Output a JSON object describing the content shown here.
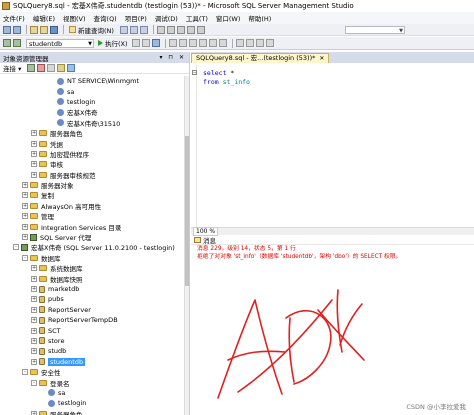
{
  "window": {
    "title": "SQLQuery8.sql - 宏基X伟奇.studentdb (testlogin (53))* - Microsoft SQL Server Management Studio"
  },
  "menu": [
    "文件(F)",
    "编辑(E)",
    "视图(V)",
    "查询(Q)",
    "项目(P)",
    "调试(D)",
    "工具(T)",
    "窗口(W)",
    "帮助(H)"
  ],
  "toolbar": {
    "new_query": "新建查询(N)",
    "database": "studentdb",
    "execute": "执行(X)"
  },
  "object_explorer": {
    "title": "对象资源管理器",
    "header_controls": "▾ ⊓ ✕",
    "connect_label": "连接 ▾",
    "tree": [
      {
        "label": "NT SERVICE\\Winmgmt",
        "icon": "user-icon",
        "level": 5,
        "expander": ""
      },
      {
        "label": "sa",
        "icon": "user-icon",
        "level": 5,
        "expander": ""
      },
      {
        "label": "testlogin",
        "icon": "user-icon",
        "level": 5,
        "expander": ""
      },
      {
        "label": "宏基X伟奇",
        "icon": "user-icon",
        "level": 5,
        "expander": ""
      },
      {
        "label": "宏基X伟奇\\31510",
        "icon": "user-icon",
        "level": 5,
        "expander": ""
      },
      {
        "label": "服务器角色",
        "icon": "folder-icon",
        "level": 3,
        "expander": "+"
      },
      {
        "label": "凭据",
        "icon": "folder-icon",
        "level": 3,
        "expander": "+"
      },
      {
        "label": "加密提供程序",
        "icon": "folder-icon",
        "level": 3,
        "expander": "+"
      },
      {
        "label": "审核",
        "icon": "folder-icon",
        "level": 3,
        "expander": "+"
      },
      {
        "label": "服务器审核规范",
        "icon": "folder-icon",
        "level": 3,
        "expander": "+"
      },
      {
        "label": "服务器对象",
        "icon": "folder-icon",
        "level": 2,
        "expander": "+"
      },
      {
        "label": "复制",
        "icon": "folder-icon",
        "level": 2,
        "expander": "+"
      },
      {
        "label": "AlwaysOn 高可用性",
        "icon": "folder-icon",
        "level": 2,
        "expander": "+"
      },
      {
        "label": "管理",
        "icon": "folder-icon",
        "level": 2,
        "expander": "+"
      },
      {
        "label": "Integration Services 目录",
        "icon": "folder-icon",
        "level": 2,
        "expander": "+"
      },
      {
        "label": "SQL Server 代理",
        "icon": "server-icon",
        "level": 2,
        "expander": "+"
      },
      {
        "label": "宏基X伟奇 (SQL Server 11.0.2100 - testlogin)",
        "icon": "server-icon",
        "level": 1,
        "expander": "-"
      },
      {
        "label": "数据库",
        "icon": "folder-icon",
        "level": 2,
        "expander": "-"
      },
      {
        "label": "系统数据库",
        "icon": "folder-icon",
        "level": 3,
        "expander": "+"
      },
      {
        "label": "数据库快照",
        "icon": "folder-icon",
        "level": 3,
        "expander": "+"
      },
      {
        "label": "marketdb",
        "icon": "db-icon",
        "level": 3,
        "expander": "+"
      },
      {
        "label": "pubs",
        "icon": "db-icon",
        "level": 3,
        "expander": "+"
      },
      {
        "label": "ReportServer",
        "icon": "db-icon",
        "level": 3,
        "expander": "+"
      },
      {
        "label": "ReportServerTempDB",
        "icon": "db-icon",
        "level": 3,
        "expander": "+"
      },
      {
        "label": "SCT",
        "icon": "db-icon",
        "level": 3,
        "expander": "+"
      },
      {
        "label": "store",
        "icon": "db-icon",
        "level": 3,
        "expander": "+"
      },
      {
        "label": "studb",
        "icon": "db-icon",
        "level": 3,
        "expander": "+"
      },
      {
        "label": "studentdb",
        "icon": "db-icon",
        "level": 3,
        "expander": "+",
        "selected": true
      },
      {
        "label": "安全性",
        "icon": "folder-icon",
        "level": 2,
        "expander": "-"
      },
      {
        "label": "登录名",
        "icon": "folder-icon",
        "level": 3,
        "expander": "-"
      },
      {
        "label": "sa",
        "icon": "user-icon",
        "level": 4,
        "expander": ""
      },
      {
        "label": "testlogin",
        "icon": "user-icon",
        "level": 4,
        "expander": ""
      },
      {
        "label": "服务器角色",
        "icon": "folder-icon",
        "level": 3,
        "expander": "+"
      }
    ]
  },
  "editor": {
    "tab_label": "SQLQuery8.sql - 宏...(testlogin (53))*",
    "tab_close": "✕",
    "line1_kw": "select",
    "line1_rest": " *",
    "line2_kw": "from",
    "line2_table": "st_info"
  },
  "zoom": {
    "level": "100 %"
  },
  "messages": {
    "tab_label": "消息",
    "line1": "消息 229，级别 14，状态 5，第 1 行",
    "line2": "拒绝了对对象 'st_info'（数据库 'studentdb'，架构 'dbo'）的 SELECT 权限。"
  },
  "watermark": "CSDN @小李拉爱我",
  "colors": {
    "error_text": "#e00000",
    "keyword": "#0000ff",
    "selected_bg": "#3399ff",
    "scribble": "#e02020"
  }
}
